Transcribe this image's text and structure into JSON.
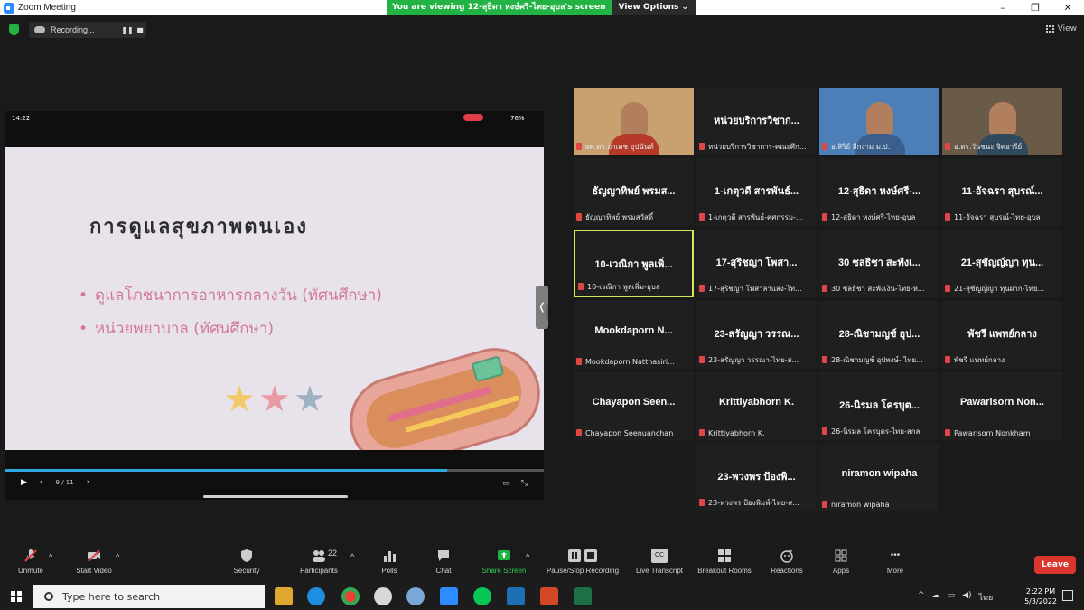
{
  "window": {
    "title": "Zoom Meeting",
    "min": "–",
    "max": "❐",
    "close": "✕"
  },
  "banner": {
    "viewing": "You are viewing 12-สุธิดา หงษ์ศรี-ไทย-อุบล's screen",
    "view_options": "View Options ⌄"
  },
  "recording": {
    "label": "Recording...",
    "pause": "❚❚",
    "stop": "■"
  },
  "view_button": {
    "label": "View"
  },
  "share": {
    "phone_time": "14:22",
    "battery": "76%",
    "slide_title": "การดูแลสุขภาพตนเอง",
    "bullets": [
      "ดูแลโภชนาการอาหารกลางวัน (ทัศนศึกษา)",
      "หน่วยพยาบาล (ทัศนศึกษา)"
    ],
    "page_indicator": "9 / 11",
    "progress": 0.82,
    "handle": "❬",
    "play": "▶",
    "prev": "‹",
    "next": "›",
    "cc": "▭",
    "expand": "⤡"
  },
  "star_colors": [
    "#f4c96a",
    "#e99aa4",
    "#9fb2c2"
  ],
  "participants": [
    {
      "big": "",
      "caption": "ผศ.ดร.อาเดช อุปนันท์",
      "video": true,
      "bg": "#c9a171",
      "shirt": "#b63a2a"
    },
    {
      "big": "หน่วยบริการวิชาก...",
      "caption": "หน่วยบริการวิชาการ-คณะศึก...",
      "video": false
    },
    {
      "big": "",
      "caption": "อ.สิริย์ สีกงาม ม.ป.",
      "video": true,
      "bg": "#4c7fb8",
      "shirt": "#3a5f8d"
    },
    {
      "big": "",
      "caption": "อ.ดร.วันชนะ จิตอารีย์",
      "video": true,
      "bg": "#6a5a48",
      "shirt": "#2f4a5c"
    },
    {
      "big": "ธัญญาทิพย์ พรมส...",
      "caption": "ธัญญาทิพย์ พรมสวัสดิ์",
      "video": false
    },
    {
      "big": "1-เกตุวดี สารพันธ์...",
      "caption": "1-เกตุวดี สารพันธ์-ศศกรรม-...",
      "video": false
    },
    {
      "big": "12-สุธิดา หงษ์ศรี-...",
      "caption": "12-สุธิดา หงษ์ศรี-ไทย-อุบล",
      "video": false
    },
    {
      "big": "11-อัจฉรา สุบรณ์...",
      "caption": "11-อัจฉรา สุบรณ์-ไทย-อุบล",
      "video": false
    },
    {
      "big": "10-เวณิกา พูลเพิ่...",
      "caption": "10-เวณิกา พูลเพิ่ม-อุบล",
      "video": false,
      "active": true
    },
    {
      "big": "17-สุริชญา โพสา...",
      "caption": "17-สุริชญา โพสาลาแสง-ไท...",
      "video": false
    },
    {
      "big": "30 ชลธิชา สะพังเ...",
      "caption": "30 ชลธิชา สะพังเงิน-ไทย-ห...",
      "video": false
    },
    {
      "big": "21-สุชัญญ์ญา ทุน...",
      "caption": "21-สุชัญญ์ญา ทุนผาก-ไทย...",
      "video": false
    },
    {
      "big": "Mookdaporn N...",
      "caption": "Mookdaporn Natthasiri...",
      "video": false
    },
    {
      "big": "23-สรัญญา วรรณ...",
      "caption": "23-สรัญญา วรรณา-ไทย-ส...",
      "video": false
    },
    {
      "big": "28-ณิชามญช์ อุป...",
      "caption": "28-ณิชามญช์ อุปพงษ์- ไทย...",
      "video": false
    },
    {
      "big": "พัชรี แพทย์กลาง",
      "caption": "พัชรี แพทย์กลาง",
      "video": false
    },
    {
      "big": "Chayapon Seen...",
      "caption": "Chayapon Seenuanchan",
      "video": false
    },
    {
      "big": "Krittiyabhorn K.",
      "caption": "Krittiyabhorn K.",
      "video": false
    },
    {
      "big": "26-นิรมล โครบุต...",
      "caption": "26-นิรมล โครบุตร-ไทย-สกล",
      "video": false
    },
    {
      "big": "Pawarisorn Non...",
      "caption": "Pawarisorn Nonkham",
      "video": false
    },
    {
      "big": "23-พวงพร ป้องพิ...",
      "caption": "23-พวงพร ป้องพิมพ์-ไทย-ส...",
      "video": false
    },
    {
      "big": "niramon wipaha",
      "caption": "niramon wipaha",
      "video": false
    }
  ],
  "toolbar": {
    "unmute": "Unmute",
    "start_video": "Start Video",
    "security": "Security",
    "participants": "Participants",
    "participants_count": "22",
    "polls": "Polls",
    "chat": "Chat",
    "share_screen": "Share Screen",
    "record": "Pause/Stop Recording",
    "live_transcript": "Live Transcript",
    "cc_icon": "CC",
    "breakout": "Breakout Rooms",
    "reactions": "Reactions",
    "apps": "Apps",
    "more": "More",
    "more_icon": "•••",
    "leave": "Leave",
    "caret": "^"
  },
  "taskbar": {
    "search_placeholder": "Type here to search",
    "time": "2:22 PM",
    "date": "5/3/2022",
    "lang": "ไทย",
    "tray_up": "^",
    "tray_cloud": "☁",
    "tray_wifi": "▭",
    "tray_speaker": "◀)"
  }
}
